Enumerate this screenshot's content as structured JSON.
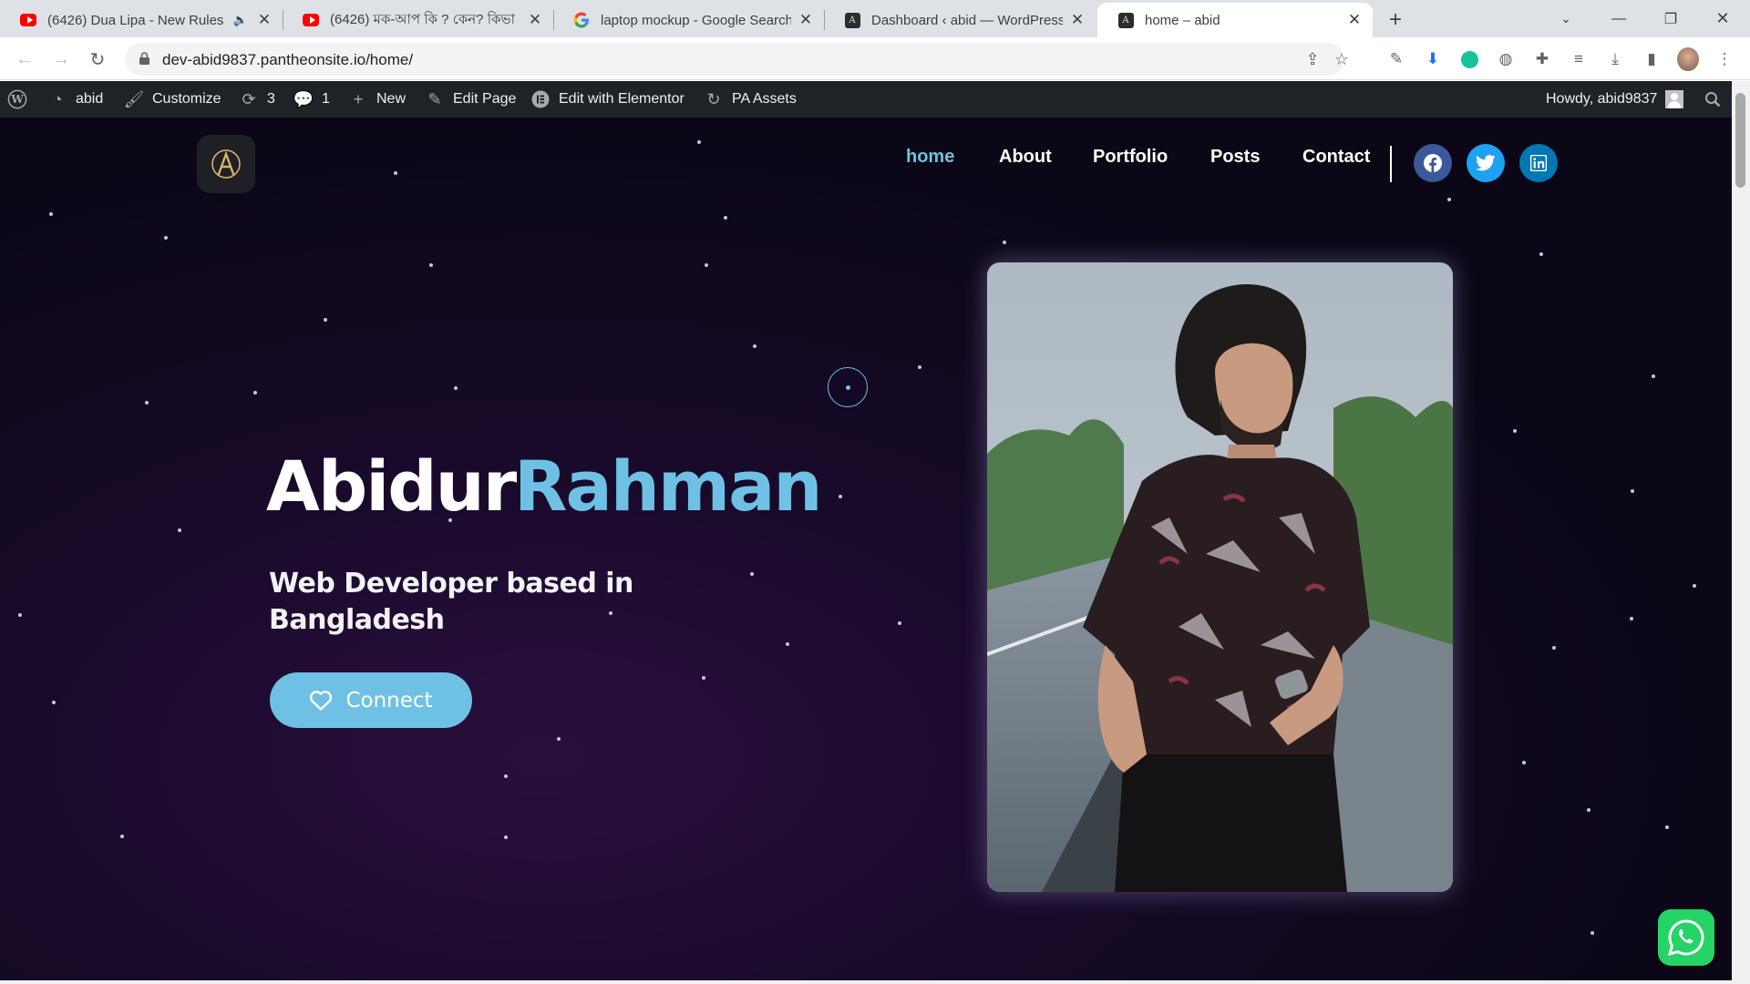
{
  "browser": {
    "tabs": [
      {
        "title": "(6426) Dua Lipa - New Rules",
        "favicon": "youtube-icon",
        "muted": true
      },
      {
        "title": "(6426) মক-আপ কি ? কেন? কিভা",
        "favicon": "youtube-icon"
      },
      {
        "title": "laptop mockup - Google Search",
        "favicon": "google-icon"
      },
      {
        "title": "Dashboard ‹ abid — WordPress",
        "favicon": "wordpress-site-icon"
      },
      {
        "title": "home – abid",
        "favicon": "wordpress-site-icon",
        "active": true
      }
    ],
    "url": "dev-abid9837.pantheonsite.io/home/"
  },
  "adminbar": {
    "site": "abid",
    "customize": "Customize",
    "updates": "3",
    "comments": "1",
    "new": "New",
    "edit_page": "Edit Page",
    "elementor": "Edit with Elementor",
    "pa_assets": "PA Assets",
    "howdy": "Howdy, abid9837"
  },
  "site": {
    "nav": [
      "home",
      "About",
      "Portfolio",
      "Posts",
      "Contact"
    ],
    "social": [
      {
        "name": "facebook",
        "color": "#3b5998"
      },
      {
        "name": "twitter",
        "color": "#1da1f2"
      },
      {
        "name": "linkedin",
        "color": "#0077b5"
      }
    ],
    "hero": {
      "first_name": "Abidur",
      "last_name": "Rahman",
      "subtitle": "Web Developer based in Bangladesh",
      "cta": "Connect"
    },
    "accent": "#6ec1e4",
    "whatsapp_color": "#25d366"
  }
}
